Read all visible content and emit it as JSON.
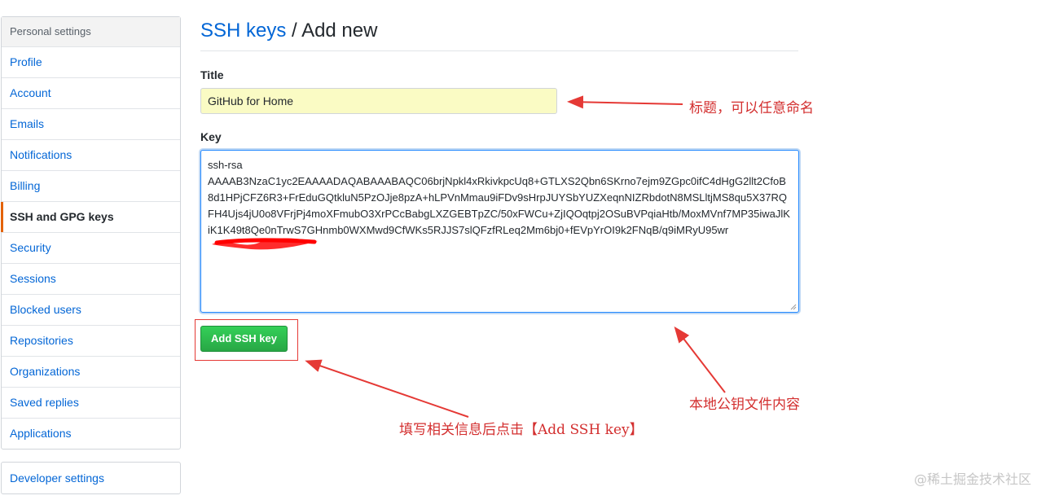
{
  "sidebar": {
    "heading": "Personal settings",
    "items": [
      {
        "label": "Profile"
      },
      {
        "label": "Account"
      },
      {
        "label": "Emails"
      },
      {
        "label": "Notifications"
      },
      {
        "label": "Billing"
      },
      {
        "label": "SSH and GPG keys",
        "selected": true
      },
      {
        "label": "Security"
      },
      {
        "label": "Sessions"
      },
      {
        "label": "Blocked users"
      },
      {
        "label": "Repositories"
      },
      {
        "label": "Organizations"
      },
      {
        "label": "Saved replies"
      },
      {
        "label": "Applications"
      }
    ],
    "developer_settings": "Developer settings"
  },
  "header": {
    "breadcrumb_link": "SSH keys",
    "separator": " / ",
    "current": "Add new"
  },
  "form": {
    "title_label": "Title",
    "title_value": "GitHub for Home",
    "key_label": "Key",
    "key_value": "ssh-rsa\nAAAAB3NzaC1yc2EAAAADAQABAAABAQC06brjNpkl4xRkivkpcUq8+GTLXS2Qbn6SKrno7ejm9ZGpc0ifC4dHgG2llt2CfoB8d1HPjCFZ6R3+FrEduGQtkluN5PzOJje8pzA+hLPVnMmau9iFDv9sHrpJUYSbYUZXeqnNIZRbdotN8MSLltjMS8qu5X37RQFH4Ujs4jU0o8VFrjPj4moXFmubO3XrPCcBabgLXZGEBTpZC/50xFWCu+ZjIQOqtpj2OSuBVPqiaHtb/MoxMVnf7MP35iwaJlKiK1K49t8Qe0nTrwS7GHnmb0WXMwd9CfWKs5RJJS7slQFzfRLeq2Mm6bj0+fEVpYrOI9k2FNqB/q9iMRyU95wr",
    "submit_label": "Add SSH key"
  },
  "annotations": {
    "title_note": "标题，可以任意命名",
    "key_note": "本地公钥文件内容",
    "button_note": "填写相关信息后点击【Add SSH key】"
  },
  "watermark": "@稀土掘金技术社区",
  "colors": {
    "link": "#0366d6",
    "selected_marker": "#e36209",
    "button_green": "#28a745",
    "annotation_red": "#e53935",
    "title_input_bg": "#fafbc4"
  }
}
